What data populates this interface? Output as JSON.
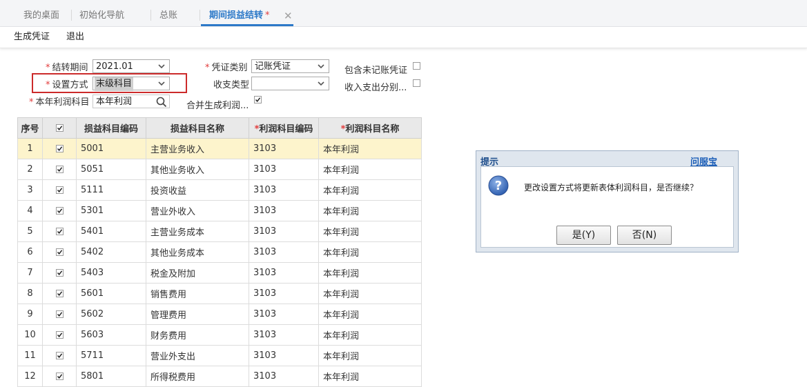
{
  "tabs": [
    {
      "label": "我的桌面"
    },
    {
      "label": "初始化导航"
    },
    {
      "label": "总账"
    },
    {
      "label": "期间损益结转",
      "modified_mark": "*",
      "close_glyph": "✕"
    }
  ],
  "toolbar": {
    "generate_label": "生成凭证",
    "exit_label": "退出"
  },
  "form": {
    "period_label": "结转期间",
    "period_value": "2021.01",
    "mode_label": "设置方式",
    "mode_value": "末级科目",
    "profit_account_label": "本年利润科目",
    "profit_account_value": "本年利润",
    "voucher_type_label": "凭证类别",
    "voucher_type_value": "记账凭证",
    "income_type_label": "收支类型",
    "income_type_value": "",
    "merge_label": "合并生成利润...",
    "include_unposted_label": "包含未记账凭证",
    "income_split_label": "收入支出分别...",
    "required_mark": "*"
  },
  "table": {
    "headers": {
      "index": "序号",
      "code": "损益科目编码",
      "name": "损益科目名称",
      "profit_code": "利润科目编码",
      "profit_name": "利润科目名称"
    },
    "rows": [
      {
        "index": "1",
        "code": "5001",
        "name": "主营业务收入",
        "profit_code": "3103",
        "profit_name": "本年利润"
      },
      {
        "index": "2",
        "code": "5051",
        "name": "其他业务收入",
        "profit_code": "3103",
        "profit_name": "本年利润"
      },
      {
        "index": "3",
        "code": "5111",
        "name": "投资收益",
        "profit_code": "3103",
        "profit_name": "本年利润"
      },
      {
        "index": "4",
        "code": "5301",
        "name": "营业外收入",
        "profit_code": "3103",
        "profit_name": "本年利润"
      },
      {
        "index": "5",
        "code": "5401",
        "name": "主营业务成本",
        "profit_code": "3103",
        "profit_name": "本年利润"
      },
      {
        "index": "6",
        "code": "5402",
        "name": "其他业务成本",
        "profit_code": "3103",
        "profit_name": "本年利润"
      },
      {
        "index": "7",
        "code": "5403",
        "name": "税金及附加",
        "profit_code": "3103",
        "profit_name": "本年利润"
      },
      {
        "index": "8",
        "code": "5601",
        "name": "销售费用",
        "profit_code": "3103",
        "profit_name": "本年利润"
      },
      {
        "index": "9",
        "code": "5602",
        "name": "管理费用",
        "profit_code": "3103",
        "profit_name": "本年利润"
      },
      {
        "index": "10",
        "code": "5603",
        "name": "财务费用",
        "profit_code": "3103",
        "profit_name": "本年利润"
      },
      {
        "index": "11",
        "code": "5711",
        "name": "营业外支出",
        "profit_code": "3103",
        "profit_name": "本年利润"
      },
      {
        "index": "12",
        "code": "5801",
        "name": "所得税费用",
        "profit_code": "3103",
        "profit_name": "本年利润"
      }
    ]
  },
  "dialog": {
    "title": "提示",
    "help_link": "问服宝",
    "message": "更改设置方式将更新表体利润科目，是否继续？",
    "yes_label": "是(Y)",
    "no_label": "否(N)"
  },
  "colors": {
    "accent": "#2c79c8",
    "required": "#e23b3b",
    "selected_row": "#fdf4cc",
    "highlight_border": "#cc2a2a"
  },
  "icons": [
    "search-icon",
    "question-icon",
    "chevron-down-icon",
    "close-icon",
    "check-icon"
  ]
}
